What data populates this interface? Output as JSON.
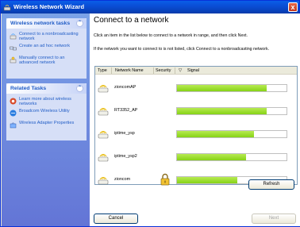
{
  "window": {
    "title": "Wireless Network Wizard",
    "close_label": "x"
  },
  "sidebar": {
    "network_tasks": {
      "title": "Wireless network tasks",
      "collapse_glyph": "⌃",
      "items": [
        {
          "label": "Connect to a nonbroadcasting network",
          "icon": "wireless-network-icon"
        },
        {
          "label": "Create an ad hoc network",
          "icon": "ad-hoc-network-icon"
        },
        {
          "label": "Manually connect to an advanced network",
          "icon": "advanced-network-icon"
        }
      ]
    },
    "related_tasks": {
      "title": "Related Tasks",
      "collapse_glyph": "⌃",
      "items": [
        {
          "label": "Learn more about wireless networks",
          "icon": "help-icon"
        },
        {
          "label": "Broadcom Wireless Utility",
          "icon": "utility-icon"
        },
        {
          "label": "Wireless Adapter Properties",
          "icon": "adapter-properties-icon"
        }
      ]
    }
  },
  "main": {
    "heading": "Connect to a network",
    "instruction": "Click an item in the list below to connect to a network in range, and then click Next.",
    "hint": "If the network you want to connect to is not listed, click Connect to a nonbroadcasting network.",
    "columns": {
      "type": "Type",
      "name": "Network Name",
      "security": "Security",
      "sort_glyph": "▽",
      "signal": "Signal"
    },
    "networks": [
      {
        "name": "zioncomAP",
        "secured": false,
        "signal": 0.82
      },
      {
        "name": "RT3352_AP",
        "secured": false,
        "signal": 0.82
      },
      {
        "name": "iptime_ysp",
        "secured": false,
        "signal": 0.7
      },
      {
        "name": "iptime_ysp2",
        "secured": false,
        "signal": 0.63
      },
      {
        "name": "zioncom",
        "secured": true,
        "signal": 0.55
      }
    ],
    "refresh_label": "Refresh"
  },
  "footer": {
    "cancel_label": "Cancel",
    "next_label": "Next"
  }
}
